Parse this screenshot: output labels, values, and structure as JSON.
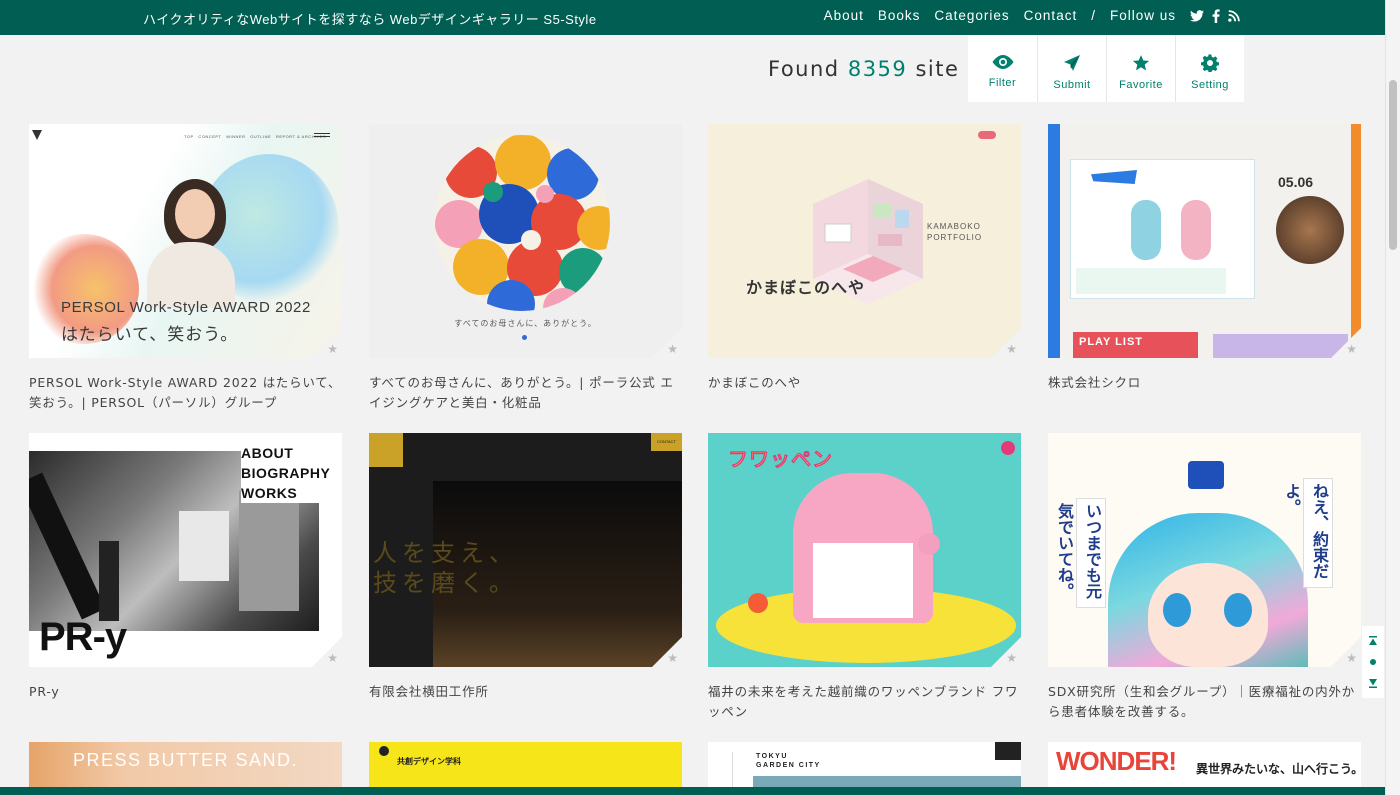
{
  "header": {
    "tagline": "ハイクオリティなWebサイトを探すなら Webデザインギャラリー S5-Style",
    "nav": [
      "About",
      "Books",
      "Categories",
      "Contact",
      "/",
      "Follow us"
    ],
    "social_icons": [
      "twitter-icon",
      "facebook-icon",
      "rss-icon"
    ]
  },
  "found": {
    "prefix": "Found",
    "count": "8359",
    "suffix": "site"
  },
  "toolbar": [
    {
      "label": "Filter",
      "icon": "eye-icon"
    },
    {
      "label": "Submit",
      "icon": "paper-plane-icon"
    },
    {
      "label": "Favorite",
      "icon": "star-icon"
    },
    {
      "label": "Setting",
      "icon": "gear-icon"
    }
  ],
  "cards": [
    {
      "title": "PERSOL Work-Style AWARD 2022 はたらいて、笑おう。| PERSOL（パーソル）グループ",
      "thumb": {
        "headline": "PERSOL Work-Style AWARD 2022",
        "sub": "はたらいて、笑おう。"
      }
    },
    {
      "title": "すべてのお母さんに、ありがとう。| ポーラ公式 エイジングケアと美白・化粧品",
      "thumb": {
        "caption": "すべてのお母さんに、ありがとう。"
      }
    },
    {
      "title": "かまぼこのへや",
      "thumb": {
        "en": "KAMABOKO PORTFOLIO",
        "jp": "かまぼこのへや"
      }
    },
    {
      "title": "株式会社シクロ",
      "thumb": {
        "date": "05.06",
        "playlist": "PLAY LIST"
      }
    },
    {
      "title": "PR-y",
      "thumb": {
        "menu": "ABOUT BIOGRAPHY WORKS",
        "logo": "PR-y"
      }
    },
    {
      "title": "有限会社横田工作所",
      "thumb": {
        "copy": "人を支え、技を磨く。",
        "btn": "CONTACT"
      }
    },
    {
      "title": "福井の未来を考えた越前織のワッペンブランド フワッペン",
      "thumb": {
        "logo": "フワッペン"
      }
    },
    {
      "title": "SDX研究所（生和会グループ）｜医療福祉の内外から患者体験を改善する。",
      "thumb": {
        "v1": "いつまでも元気でいてね。",
        "v2": "ねえ、約束だよ。"
      }
    },
    {
      "title": "",
      "thumb": {
        "text": "PRESS BUTTER SAND."
      }
    },
    {
      "title": "",
      "thumb": {
        "text": "共創デザイン学科"
      }
    },
    {
      "title": "",
      "thumb": {
        "text": "TOKYU GARDEN CITY"
      }
    },
    {
      "title": "",
      "thumb": {
        "big": "WONDER!",
        "sub": "異世界みたいな、山へ行こう。"
      }
    }
  ]
}
